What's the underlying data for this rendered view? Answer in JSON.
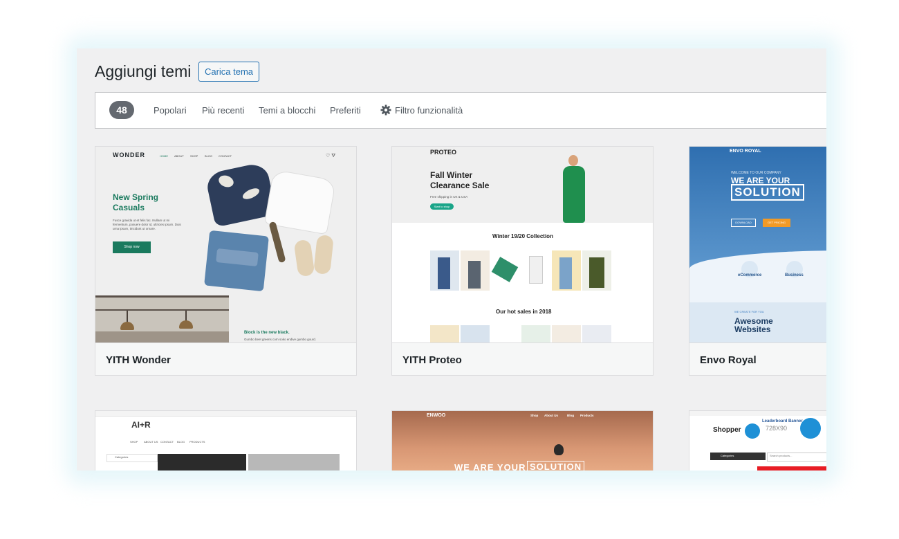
{
  "header": {
    "title": "Aggiungi temi",
    "upload_label": "Carica tema"
  },
  "filters": {
    "count": "48",
    "tabs": [
      "Popolari",
      "Più recenti",
      "Temi a blocchi",
      "Preferiti"
    ],
    "feature_filter": "Filtro funzionalità"
  },
  "themes": [
    {
      "name": "YITH Wonder",
      "preview": {
        "logo": "WONDER",
        "nav": [
          "HOME",
          "ABOUT",
          "SHOP",
          "BLOG",
          "CONTACT"
        ],
        "headline_1": "New Spring",
        "headline_2": "Casuals",
        "body": "Fusce gravida ut et felis fac. Nullam ut mi fermentum, posuere dolor id, ultricies ipsum. Duis urna ipsum, tincidunt ut ornare.",
        "cta": "Shop now",
        "banner_title": "Block is the new black.",
        "banner_text": "Gumbo beet greens corn soko endive gumbo gourd."
      }
    },
    {
      "name": "YITH Proteo",
      "preview": {
        "logo": "PROTEO",
        "headline_1": "Fall Winter",
        "headline_2": "Clearance Sale",
        "sub": "Free shipping in UK & USA",
        "cta": "Start to shop",
        "section_1": "Winter 19/20 Collection",
        "section_2": "Our hot sales in 2018"
      }
    },
    {
      "name": "Envo Royal",
      "preview": {
        "logo": "ENVO ROYAL",
        "kicker": "WELCOME TO OUR COMPANY",
        "headline": "WE ARE YOUR",
        "headline_box": "SOLUTION",
        "btn_1": "DOWNLOAD",
        "btn_2": "GET PRICING",
        "feat_1": "eCommerce",
        "feat_2": "Business",
        "tag": "WE CREATE FOR YOU",
        "bottom_1": "Awesome",
        "bottom_2": "Websites"
      }
    },
    {
      "name": "",
      "preview": {
        "logo": "AI+R",
        "nav": [
          "SHOP",
          "ABOUT US",
          "CONTACT",
          "BLOG",
          "PRODUCTS"
        ],
        "side": "Categories"
      }
    },
    {
      "name": "",
      "preview": {
        "logo": "ENWOO",
        "nav": [
          "Shop",
          "About Us",
          "Blog",
          "Products"
        ],
        "headline": "WE ARE YOUR",
        "headline_box": "SOLUTION"
      }
    },
    {
      "name": "",
      "preview": {
        "logo": "Shopper",
        "banner": "Leaderboard Banner",
        "banner_size": "728X90",
        "side": "Categories",
        "search": "Search products..."
      }
    }
  ]
}
